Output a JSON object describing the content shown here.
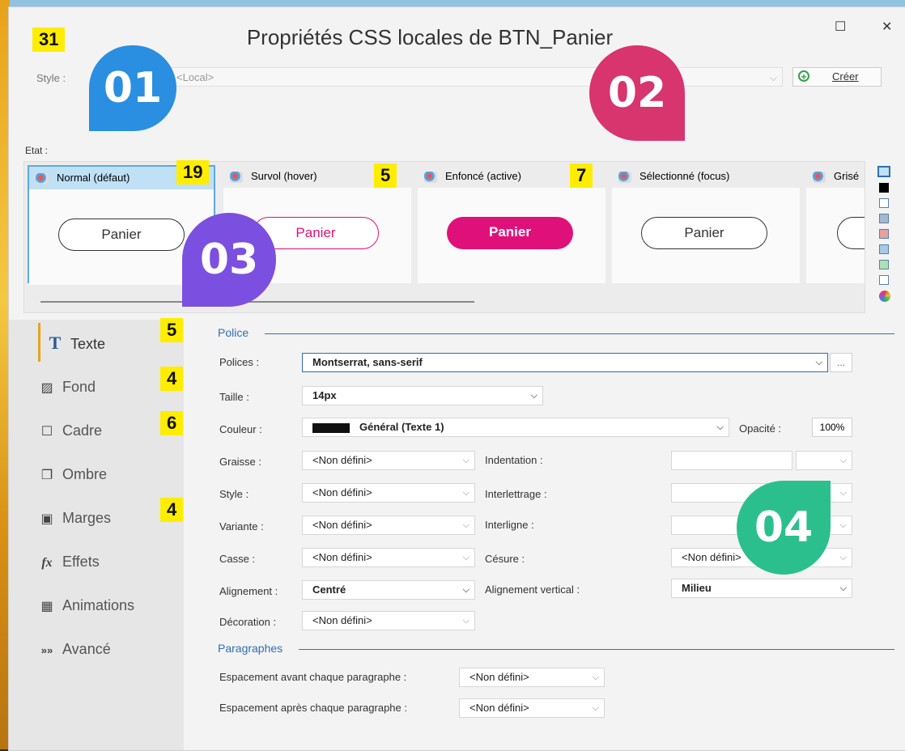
{
  "window": {
    "title": "Propriétés CSS locales de BTN_Panier",
    "maximize_icon": "☐",
    "close_icon": "✕"
  },
  "annotations": {
    "badge_31": "31",
    "badge_19": "19",
    "badge_5_hover": "5",
    "badge_7": "7",
    "badge_5_texte": "5",
    "badge_4_fond": "4",
    "badge_6": "6",
    "badge_4_marges": "4",
    "bubble_01": "01",
    "bubble_02": "02",
    "bubble_03": "03",
    "bubble_04": "04"
  },
  "style_row": {
    "label": "Style :",
    "value": "<Local>",
    "create_label": "Créer"
  },
  "states": {
    "label": "Etat :",
    "items": [
      {
        "title": "Normal (défaut)",
        "button": "Panier"
      },
      {
        "title": "Survol (hover)",
        "button": "Panier"
      },
      {
        "title": "Enfoncé (active)",
        "button": "Panier"
      },
      {
        "title": "Sélectionné (focus)",
        "button": "Panier"
      },
      {
        "title": "Grisé",
        "button": ""
      }
    ]
  },
  "sidebar": {
    "items": [
      {
        "label": "Texte",
        "icon": "T"
      },
      {
        "label": "Fond",
        "icon": "▨"
      },
      {
        "label": "Cadre",
        "icon": "☐"
      },
      {
        "label": "Ombre",
        "icon": "❐"
      },
      {
        "label": "Marges",
        "icon": "▣"
      },
      {
        "label": "Effets",
        "icon": "fx"
      },
      {
        "label": "Animations",
        "icon": "▦"
      },
      {
        "label": "Avancé",
        "icon": "»»"
      }
    ]
  },
  "police": {
    "section": "Police",
    "polices_label": "Polices :",
    "polices_value": "Montserrat, sans-serif",
    "more_label": "...",
    "taille_label": "Taille :",
    "taille_value": "14px",
    "couleur_label": "Couleur :",
    "couleur_value": "Général (Texte 1)",
    "opacite_label": "Opacité :",
    "opacite_value": "100%",
    "graisse_label": "Graisse :",
    "graisse_value": "<Non défini>",
    "style_label": "Style :",
    "style_value": "<Non défini>",
    "variante_label": "Variante :",
    "variante_value": "<Non défini>",
    "casse_label": "Casse :",
    "casse_value": "<Non défini>",
    "alignement_label": "Alignement :",
    "alignement_value": "Centré",
    "decoration_label": "Décoration :",
    "decoration_value": "<Non défini>",
    "indentation_label": "Indentation :",
    "interlettrage_label": "Interlettrage :",
    "interligne_label": "Interligne :",
    "cesure_label": "Césure :",
    "cesure_value": "<Non défini>",
    "align_vert_label": "Alignement vertical :",
    "align_vert_value": "Milieu"
  },
  "paragraphes": {
    "section": "Paragraphes",
    "avant_label": "Espacement avant chaque paragraphe :",
    "avant_value": "<Non défini>",
    "apres_label": "Espacement après chaque paragraphe :",
    "apres_value": "<Non défini>"
  },
  "colors": {
    "accent": "#e0107a",
    "section": "#2f6fb0",
    "selected_state": "#bfe0f5"
  }
}
